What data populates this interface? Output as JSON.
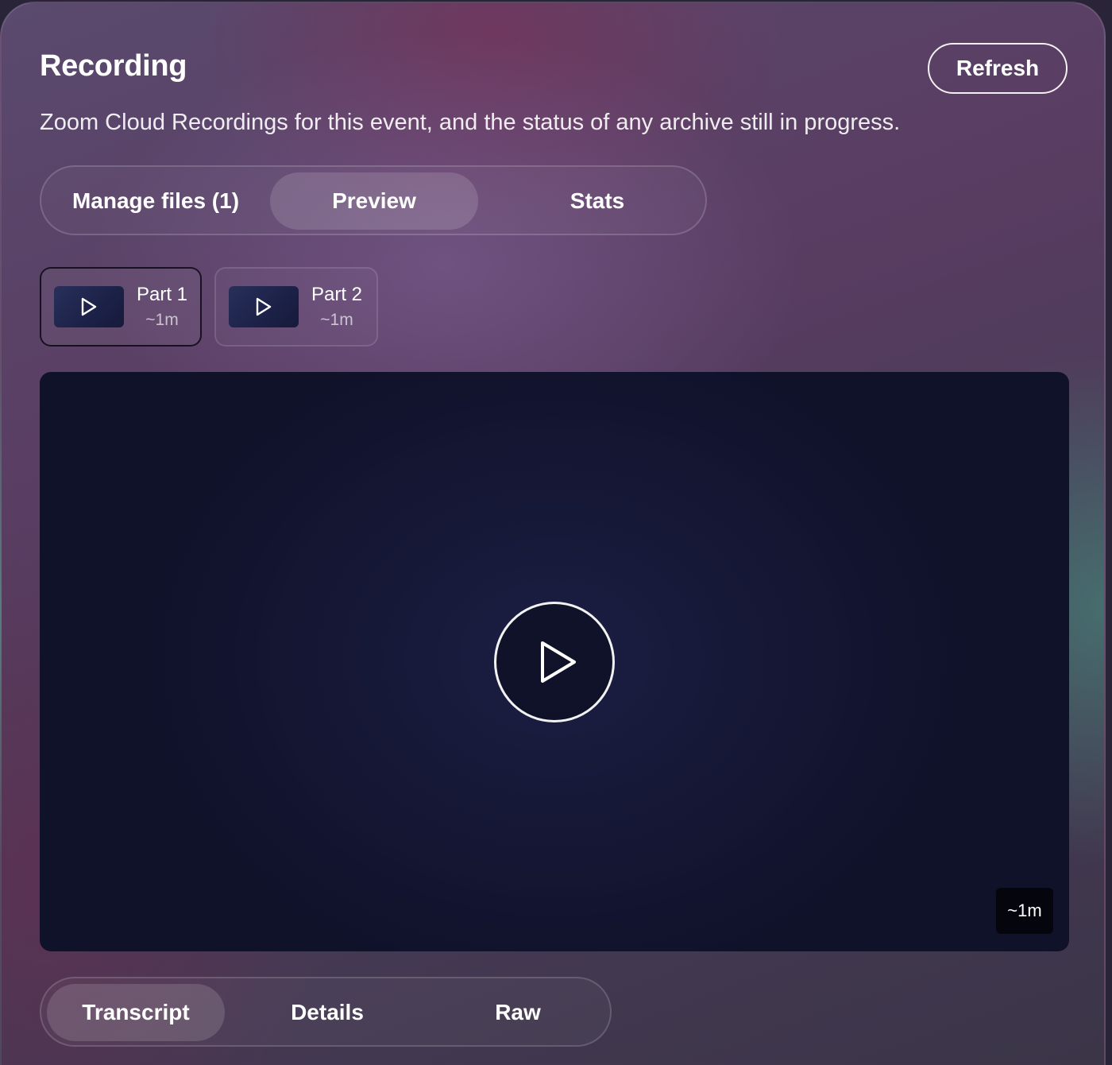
{
  "header": {
    "title": "Recording",
    "refresh_label": "Refresh",
    "subtitle": "Zoom Cloud Recordings for this event, and the status of any archive still in progress."
  },
  "top_tabs": {
    "active": "Preview",
    "items": [
      {
        "label": "Manage files (1)"
      },
      {
        "label": "Preview"
      },
      {
        "label": "Stats"
      }
    ]
  },
  "parts": {
    "selected": "Part 1",
    "items": [
      {
        "label": "Part 1",
        "duration": "~1m",
        "icon": "play-icon"
      },
      {
        "label": "Part 2",
        "duration": "~1m",
        "icon": "play-icon"
      }
    ]
  },
  "player": {
    "duration": "~1m",
    "icon": "play-icon"
  },
  "bottom_tabs": {
    "active": "Transcript",
    "items": [
      {
        "label": "Transcript"
      },
      {
        "label": "Details"
      },
      {
        "label": "Raw"
      }
    ]
  }
}
